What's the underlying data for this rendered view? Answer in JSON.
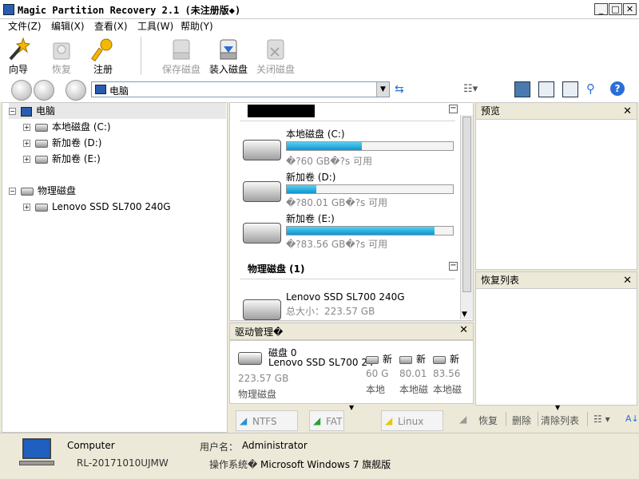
{
  "window": {
    "title": "Magic Partition Recovery 2.1 (未注册版◆)",
    "minimize": "_",
    "maximize": "□",
    "close": "✕"
  },
  "menu": [
    {
      "label": "文件(Z)"
    },
    {
      "label": "编辑(X)"
    },
    {
      "label": "查看(X)"
    },
    {
      "label": "工具(W)"
    },
    {
      "label": "帮助(Y)"
    }
  ],
  "toolbar": {
    "wizard": "向导",
    "restore": "恢复",
    "register": "注册",
    "save_disk": "保存磁盘",
    "mount_disk": "装入磁盘",
    "close_disk": "关闭磁盘"
  },
  "address": {
    "value": "电脑"
  },
  "tree": {
    "root": "电脑",
    "local_c": "本地磁盘 (C:)",
    "vol_d": "新加卷 (D:)",
    "vol_e": "新加卷 (E:)",
    "physical": "物理磁盘",
    "ssd": "Lenovo SSD SL700 240G",
    "plus": "+",
    "minus": "−"
  },
  "center": {
    "drives": [
      {
        "name": "本地磁盘 (C:)",
        "free": "�?60 GB�?s 可用",
        "fill": 0.45
      },
      {
        "name": "新加卷 (D:)",
        "free": "�?80.01 GB�?s 可用",
        "fill": 0.18
      },
      {
        "name": "新加卷 (E:)",
        "free": "�?83.56 GB�?s 可用",
        "fill": 0.89
      }
    ],
    "physical_header": "物理磁盘 (1)",
    "ssd_name": "Lenovo SSD SL700 240G",
    "ssd_size": "总大小：223.57 GB"
  },
  "drive_mgmt": {
    "title": "驱动管理�",
    "disk_label": "磁盘 0",
    "disk_model": "Lenovo SSD SL700 24",
    "disk_size": "223.57 GB",
    "disk_type": "物理磁盘",
    "parts": [
      {
        "top": "新",
        "size": "60 G",
        "name": "本地"
      },
      {
        "top": "新",
        "size": "80.01",
        "name": "本地磁"
      },
      {
        "top": "新",
        "size": "83.56",
        "name": "本地磁"
      }
    ],
    "fs_tabs": [
      "NTFS",
      "FAT",
      "Linux"
    ]
  },
  "right": {
    "preview_title": "预览",
    "recovery_title": "恢复列表",
    "restore_btn": "恢复",
    "delete_btn": "删除",
    "clear_btn": "清除列表"
  },
  "status": {
    "computer_label": "Computer",
    "computer_name": "RL-20171010UJMW",
    "user_label": "用户名：",
    "user_name": "Administrator",
    "os_label": "操作系统�",
    "os_name": "Microsoft Windows 7 旗舰版"
  },
  "colors": {
    "accent": "#0b96d0",
    "panel_bg": "#ece9d8"
  }
}
